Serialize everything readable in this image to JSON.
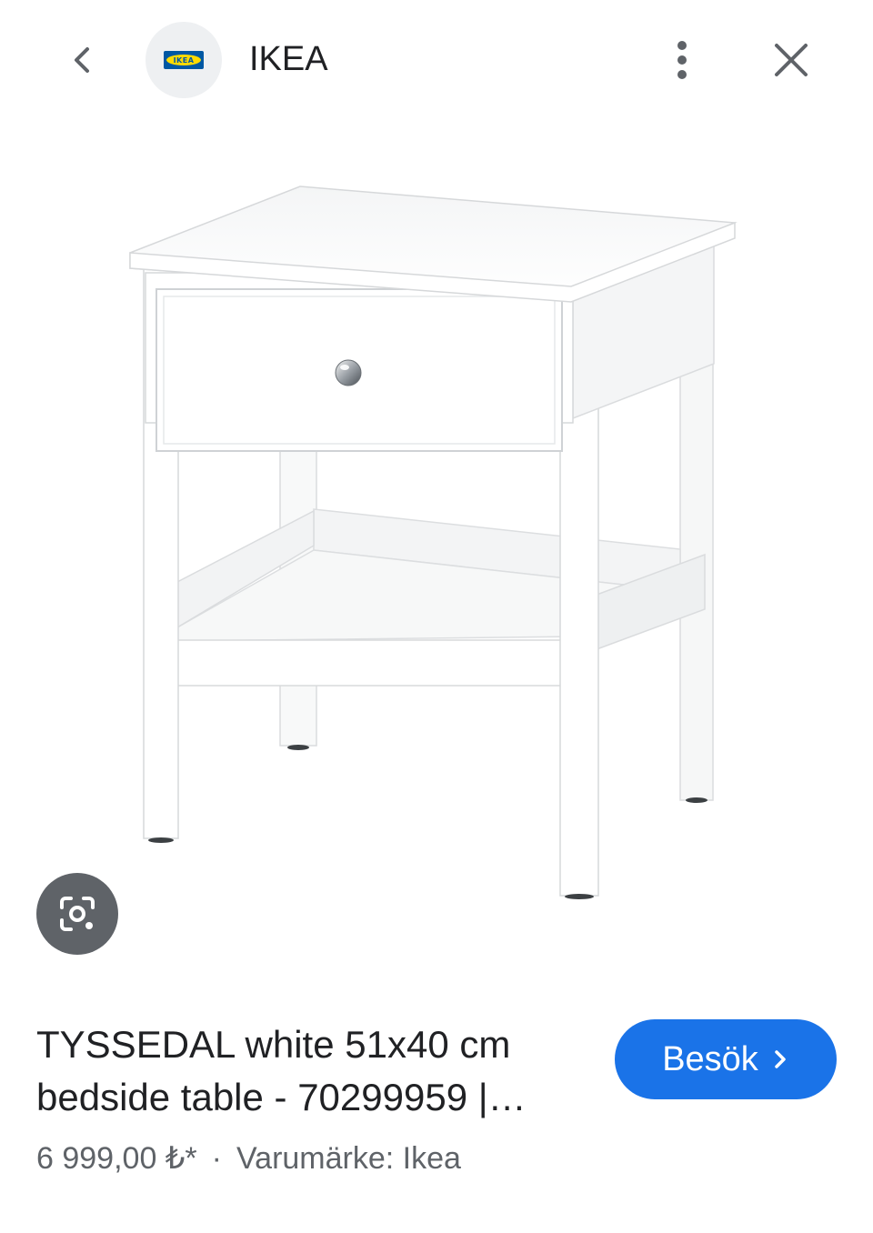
{
  "header": {
    "site_name": "IKEA",
    "logo_text": "IKEA",
    "back_icon": "chevron-left-icon",
    "more_icon": "more-vert-icon",
    "close_icon": "close-icon"
  },
  "image": {
    "lens_icon": "google-lens-icon"
  },
  "result": {
    "title_line1": "TYSSEDAL white 51x40 cm",
    "title_line2": "bedside table - 70299959 |…",
    "price": "6 999,00 ₺*",
    "separator": "·",
    "brand": "Varumärke: Ikea",
    "visit_label": "Besök"
  },
  "colors": {
    "accent": "#1a73e8",
    "lens_bg": "#5f6368",
    "ikea_blue": "#0058a3",
    "ikea_yellow": "#ffdb00"
  }
}
